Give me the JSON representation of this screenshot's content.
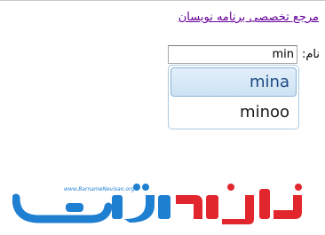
{
  "header": {
    "site_link": "مرجع تخصصی برنامه نویسان"
  },
  "form": {
    "name_label": "نام:",
    "name_value": "min"
  },
  "autocomplete": {
    "items": [
      {
        "label": "mina"
      },
      {
        "label": "minoo"
      }
    ]
  },
  "logo": {
    "url_text": "www.BarnameNevisan.org",
    "colors": {
      "blue": "#1f7fd1",
      "red": "#e2262e"
    }
  }
}
